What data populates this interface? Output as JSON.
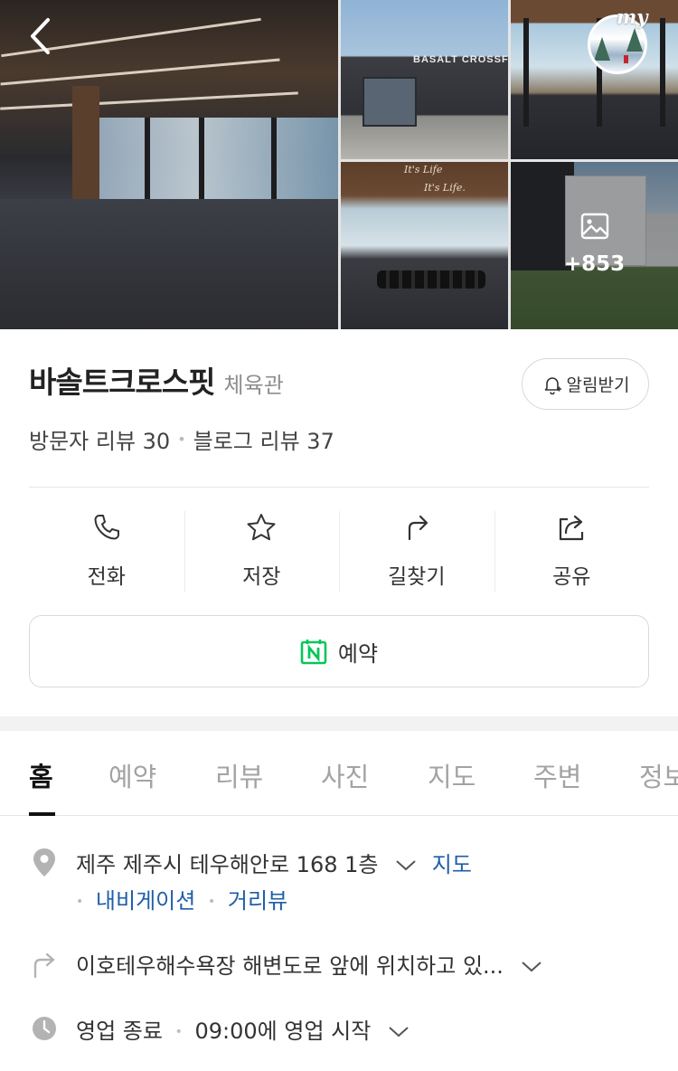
{
  "gallery": {
    "more_count": "+853",
    "main_photo_text": "",
    "photo2_sign": "BASALT CROSSFI",
    "photo4_text1": "It's Life",
    "photo4_text2": "It's Life."
  },
  "header": {
    "my_label": "my"
  },
  "place": {
    "name": "바솔트크로스핏",
    "category": "체육관",
    "alert_label": "알림받기",
    "visitor_reviews": "방문자 리뷰 30",
    "blog_reviews": "블로그 리뷰 37"
  },
  "actions": [
    {
      "label": "전화",
      "icon": "phone-icon"
    },
    {
      "label": "저장",
      "icon": "star-icon"
    },
    {
      "label": "길찾기",
      "icon": "directions-icon"
    },
    {
      "label": "공유",
      "icon": "share-icon"
    }
  ],
  "reserve": {
    "label": "예약",
    "icon_letter": "N"
  },
  "tabs": [
    "홈",
    "예약",
    "리뷰",
    "사진",
    "지도",
    "주변",
    "정보"
  ],
  "info": {
    "address": "제주 제주시 테우해안로 168 1층",
    "map_link": "지도",
    "navigation_link": "내비게이션",
    "streetview_link": "거리뷰",
    "directions_text": "이호테우해수욕장 해변도로 앞에 위치하고 있...",
    "hours_status": "영업 종료",
    "hours_next": "09:00에 영업 시작"
  },
  "colors": {
    "link": "#1f5ea8",
    "naver_green": "#03c75a",
    "active_tab": "#111111",
    "inactive_tab": "#a3a3a3"
  }
}
